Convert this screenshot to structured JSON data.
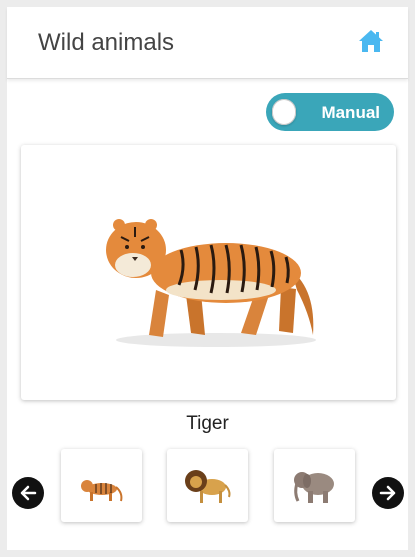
{
  "header": {
    "title": "Wild animals",
    "home_icon": "home-icon",
    "accent": "#4ab8f0"
  },
  "mode_toggle": {
    "label": "Manual",
    "state": "off",
    "color": "#3aa6b9"
  },
  "current_animal": {
    "name": "Tiger"
  },
  "carousel": {
    "prev_icon": "arrow-left-icon",
    "next_icon": "arrow-right-icon",
    "thumbnails": [
      "tiger",
      "lion",
      "elephant"
    ]
  }
}
